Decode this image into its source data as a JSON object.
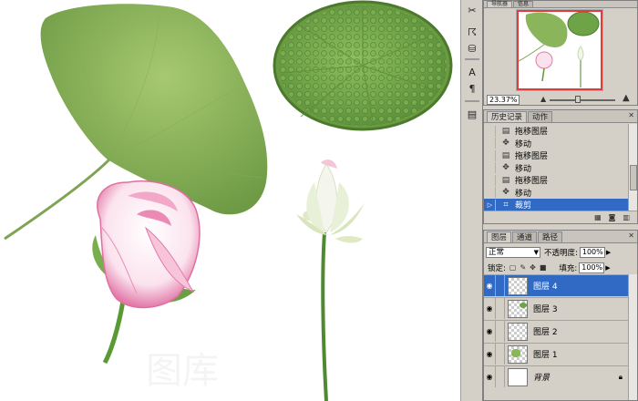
{
  "navigator": {
    "tabs": [
      "导航器",
      "信息"
    ],
    "zoom": "23.37%"
  },
  "history": {
    "tabs": [
      "历史记录",
      "动作"
    ],
    "items": [
      {
        "label": "拖移图层",
        "icon": "document-icon"
      },
      {
        "label": "移动",
        "icon": "move-icon"
      },
      {
        "label": "拖移图层",
        "icon": "document-icon"
      },
      {
        "label": "移动",
        "icon": "move-icon"
      },
      {
        "label": "拖移图层",
        "icon": "document-icon"
      },
      {
        "label": "移动",
        "icon": "move-icon"
      },
      {
        "label": "裁剪",
        "icon": "crop-icon",
        "selected": true
      }
    ]
  },
  "layers": {
    "tabs": [
      "图层",
      "通道",
      "路径"
    ],
    "blend_mode": "正常",
    "opacity_label": "不透明度:",
    "opacity": "100%",
    "lock_label": "锁定:",
    "fill_label": "填充:",
    "fill": "100%",
    "items": [
      {
        "name": "图层 4",
        "selected": true
      },
      {
        "name": "图层 3",
        "selected": false
      },
      {
        "name": "图层 2",
        "selected": false
      },
      {
        "name": "图层 1",
        "selected": false
      },
      {
        "name": "背景",
        "selected": false,
        "background": true
      }
    ]
  },
  "colors": {
    "panel_bg": "#d4d0c8",
    "selection": "#316ac5",
    "leaf_green": "#8ab55a",
    "rose_pink": "#e07aa8"
  }
}
